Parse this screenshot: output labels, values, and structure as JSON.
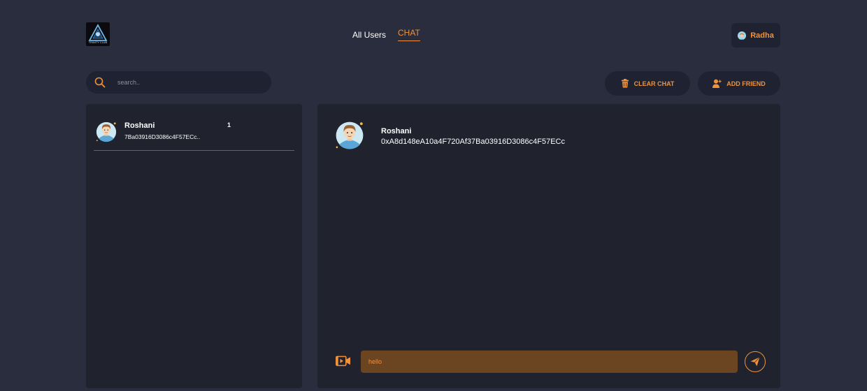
{
  "header": {
    "logo_text": "TRINITY CLUB",
    "nav": {
      "all_users": "All Users",
      "chat": "CHAT"
    },
    "user": {
      "name": "Radha"
    }
  },
  "search": {
    "placeholder": "search.."
  },
  "actions": {
    "clear_chat": "CLEAR CHAT",
    "add_friend": "ADD FRIEND"
  },
  "friends": [
    {
      "name": "Roshani",
      "address": "7Ba03916D3086c4F57ECc..",
      "badge": "1"
    }
  ],
  "chat": {
    "name": "Roshani",
    "address": "0xA8d148eA10a4F720Af37Ba03916D3086c4F57ECc",
    "message_value": "hello"
  },
  "colors": {
    "background": "#292d3d",
    "panel": "#20222e",
    "accent": "#f0913c",
    "input_fill": "#6b4421"
  },
  "icons": {
    "search": "search-icon",
    "trash": "trash-icon",
    "add_user": "add-user-icon",
    "attach": "video-attach-icon",
    "send": "send-icon"
  }
}
